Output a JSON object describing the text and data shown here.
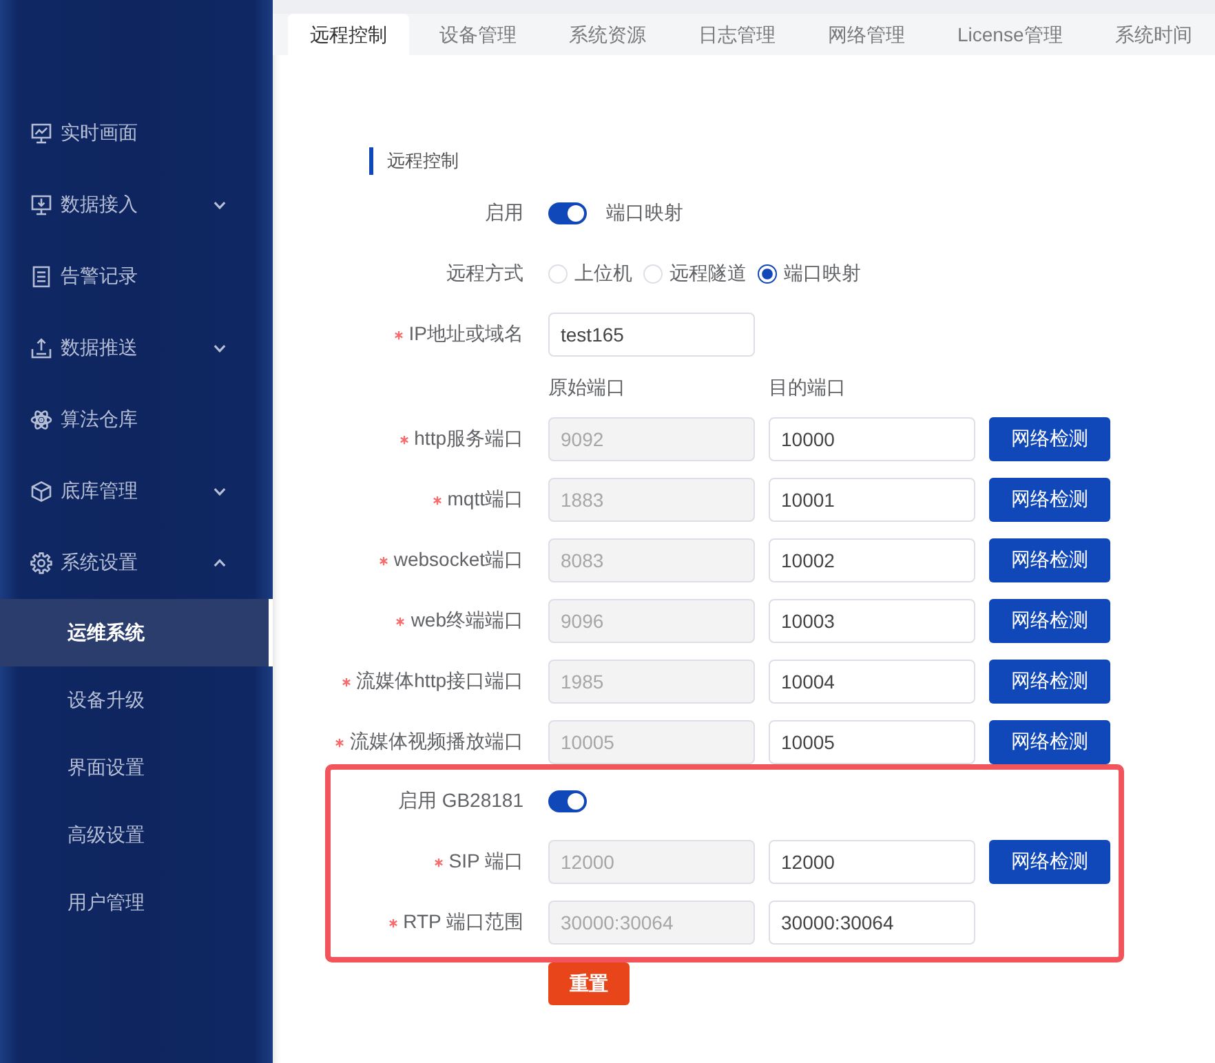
{
  "sidebar": {
    "items": [
      {
        "label": "实时画面",
        "kind": "link",
        "selected": false
      },
      {
        "label": "数据接入",
        "kind": "submenu",
        "expanded": false,
        "selected": false
      },
      {
        "label": "告警记录",
        "kind": "link",
        "selected": false
      },
      {
        "label": "数据推送",
        "kind": "submenu",
        "expanded": false,
        "selected": false
      },
      {
        "label": "算法仓库",
        "kind": "link",
        "selected": false
      },
      {
        "label": "底库管理",
        "kind": "submenu",
        "expanded": false,
        "selected": false
      },
      {
        "label": "系统设置",
        "kind": "submenu",
        "expanded": true,
        "selected": false,
        "children": [
          {
            "label": "运维系统",
            "selected": true
          },
          {
            "label": "设备升级",
            "selected": false
          },
          {
            "label": "界面设置",
            "selected": false
          },
          {
            "label": "高级设置",
            "selected": false
          },
          {
            "label": "用户管理",
            "selected": false
          }
        ]
      }
    ]
  },
  "tabs": [
    {
      "label": "远程控制",
      "selected": true
    },
    {
      "label": "设备管理",
      "selected": false
    },
    {
      "label": "系统资源",
      "selected": false
    },
    {
      "label": "日志管理",
      "selected": false
    },
    {
      "label": "网络管理",
      "selected": false
    },
    {
      "label": "License管理",
      "selected": false
    },
    {
      "label": "系统时间",
      "selected": false
    }
  ],
  "section": {
    "title": "远程控制"
  },
  "form": {
    "enable": {
      "label": "启用",
      "on": true,
      "text": "端口映射"
    },
    "remote_mode": {
      "label": "远程方式",
      "options": [
        {
          "label": "上位机",
          "selected": false
        },
        {
          "label": "远程隧道",
          "selected": false
        },
        {
          "label": "端口映射",
          "selected": true
        }
      ]
    },
    "host": {
      "label": "IP地址或域名",
      "required": true,
      "value": "test165"
    },
    "port_columns": [
      "原始端口",
      "目的端口"
    ],
    "ports": [
      {
        "label": "http服务端口",
        "required": true,
        "original": {
          "value": "9092",
          "disabled": true
        },
        "target": {
          "value": "10000",
          "disabled": false
        },
        "check_button": "网络检测"
      },
      {
        "label": "mqtt端口",
        "required": true,
        "original": {
          "value": "1883",
          "disabled": true
        },
        "target": {
          "value": "10001",
          "disabled": false
        },
        "check_button": "网络检测"
      },
      {
        "label": "websocket端口",
        "required": true,
        "original": {
          "value": "8083",
          "disabled": true
        },
        "target": {
          "value": "10002",
          "disabled": false
        },
        "check_button": "网络检测"
      },
      {
        "label": "web终端端口",
        "required": true,
        "original": {
          "value": "9096",
          "disabled": true
        },
        "target": {
          "value": "10003",
          "disabled": false
        },
        "check_button": "网络检测"
      },
      {
        "label": "流媒体http接口端口",
        "required": true,
        "original": {
          "value": "1985",
          "disabled": true
        },
        "target": {
          "value": "10004",
          "disabled": false
        },
        "check_button": "网络检测"
      },
      {
        "label": "流媒体视频播放端口",
        "required": true,
        "original": {
          "value": "10005",
          "disabled": true
        },
        "target": {
          "value": "10005",
          "disabled": false
        },
        "check_button": "网络检测"
      }
    ],
    "gb28181": {
      "highlighted": true,
      "enable": {
        "label": "启用 GB28181",
        "on": true
      },
      "ports": [
        {
          "label": "SIP 端口",
          "required": true,
          "original": {
            "value": "12000",
            "disabled": true
          },
          "target": {
            "value": "12000",
            "disabled": false
          },
          "check_button": "网络检测"
        },
        {
          "label": "RTP 端口范围",
          "required": true,
          "original": {
            "value": "30000:30064",
            "disabled": true
          },
          "target": {
            "value": "30000:30064",
            "disabled": false
          }
        }
      ]
    }
  },
  "reset_button": {
    "label": "重置"
  }
}
